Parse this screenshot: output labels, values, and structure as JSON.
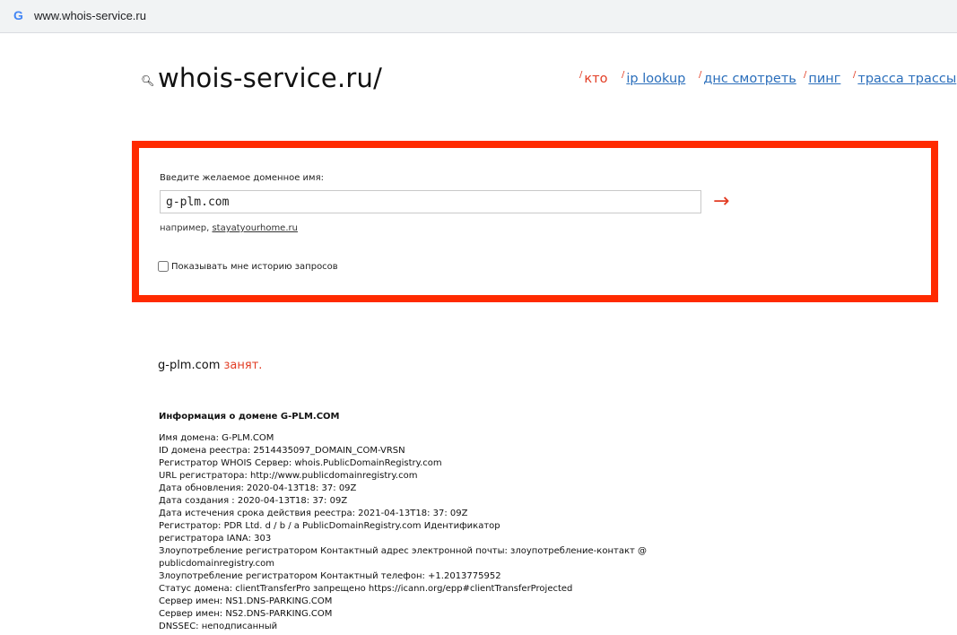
{
  "browser": {
    "logo": "G",
    "url": "www.whois-service.ru"
  },
  "header": {
    "logo_icon": "magnifier-icon",
    "title": "whois-service.ru/",
    "nav": [
      {
        "slash": "/",
        "label": "кто"
      },
      {
        "slash": "/",
        "label": "ip lookup"
      },
      {
        "slash": "/",
        "label": "днс смотреть"
      },
      {
        "slash": "/",
        "label": "пинг"
      },
      {
        "slash": "/",
        "label": "трасса трассы"
      }
    ]
  },
  "form": {
    "label": "Введите желаемое доменное имя:",
    "value": "g-plm.com",
    "submit_icon": "→",
    "example_prefix": "например, ",
    "example_link": "stayatyourhome.ru",
    "history_label": "Показывать мне историю запросов",
    "history_checked": false
  },
  "colors": {
    "accent": "#ff2a00",
    "link": "#2a6ebb"
  },
  "result": {
    "domain": "g-plm.com",
    "status": " занят.",
    "info_title": "Информация о домене G-PLM.COM",
    "lines": [
      "Имя домена: G-PLM.COM",
      "ID домена реестра: 2514435097_DOMAIN_COM-VRSN",
      "Регистратор WHOIS Сервер: whois.PublicDomainRegistry.com",
      "URL регистратора: http://www.publicdomainregistry.com",
      "Дата обновления: 2020-04-13T18: 37: 09Z",
      "Дата создания : 2020-04-13T18: 37: 09Z",
      "Дата истечения срока действия реестра: 2021-04-13T18: 37: 09Z",
      "Регистратор: PDR Ltd. d / b / a PublicDomainRegistry.com Идентификатор",
      "регистратора IANA: 303",
      "Злоупотребление регистратором Контактный адрес электронной почты: злоупотребление-контакт @",
      "publicdomainregistry.com",
      "Злоупотребление регистратором Контактный телефон: +1.2013775952",
      "Статус домена: clientTransferPro запрещено https://icann.org/epp#clientTransferProjected",
      "Сервер имен: NS1.DNS-PARKING.COM",
      "Сервер имен: NS2.DNS-PARKING.COM",
      "DNSSEC: неподписанный"
    ]
  }
}
